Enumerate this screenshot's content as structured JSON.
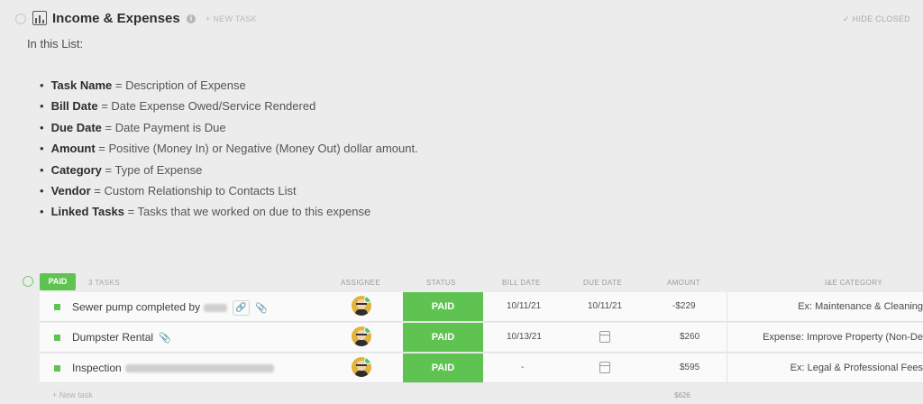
{
  "header": {
    "title": "Income & Expenses",
    "info_icon": "i",
    "new_task_label": "+ NEW TASK",
    "hide_closed_label": "✓ HIDE CLOSED"
  },
  "description": {
    "intro": "In this List:",
    "items": [
      {
        "term": "Task Name",
        "text": " = Description of Expense"
      },
      {
        "term": "Bill Date",
        "text": " = Date Expense Owed/Service Rendered"
      },
      {
        "term": "Due Date",
        "text": " = Date Payment is Due"
      },
      {
        "term": "Amount",
        "text": " = Positive (Money In) or Negative (Money Out) dollar amount."
      },
      {
        "term": "Category",
        "text": " = Type of Expense"
      },
      {
        "term": "Vendor",
        "text": " = Custom Relationship to Contacts List"
      },
      {
        "term": "Linked Tasks",
        "text": " = Tasks that we worked on due to this expense"
      }
    ]
  },
  "group": {
    "status": "PAID",
    "status_color": "#5fc352",
    "task_count": "3 TASKS",
    "columns": {
      "assignee": "ASSIGNEE",
      "status": "STATUS",
      "bill_date": "BILL DATE",
      "due_date": "DUE DATE",
      "amount": "AMOUNT",
      "category": "I&E CATEGORY"
    },
    "tasks": [
      {
        "name": "Sewer pump completed by",
        "status": "PAID",
        "bill_date": "10/11/21",
        "due_date": "10/11/21",
        "amount": "-$229",
        "category": "Ex: Maintenance & Cleaning"
      },
      {
        "name": "Dumpster Rental",
        "status": "PAID",
        "bill_date": "10/13/21",
        "due_date": "",
        "amount": "$260",
        "category": "Expense: Improve Property (Non-De"
      },
      {
        "name": "Inspection",
        "status": "PAID",
        "bill_date": "-",
        "due_date": "",
        "amount": "$595",
        "category": "Ex: Legal & Professional Fees"
      }
    ],
    "new_task": "+ New task",
    "amount_total": "$626"
  }
}
